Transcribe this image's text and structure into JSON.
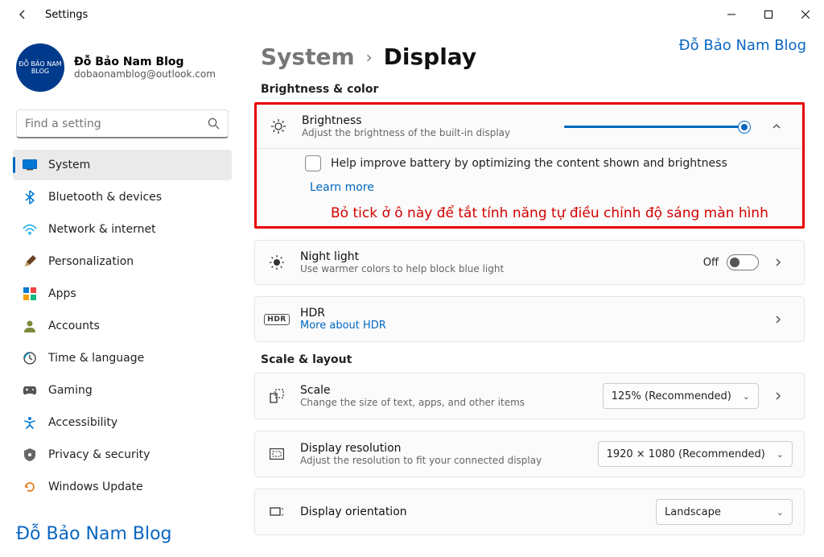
{
  "window": {
    "title": "Settings"
  },
  "user": {
    "name": "Đỗ Bảo Nam Blog",
    "email": "dobaonamblog@outlook.com",
    "avatar_text": "ĐỖ BẢO NAM BLOG"
  },
  "search": {
    "placeholder": "Find a setting"
  },
  "nav": {
    "items": [
      {
        "label": "System",
        "icon": "system"
      },
      {
        "label": "Bluetooth & devices",
        "icon": "bluetooth"
      },
      {
        "label": "Network & internet",
        "icon": "network"
      },
      {
        "label": "Personalization",
        "icon": "personalization"
      },
      {
        "label": "Apps",
        "icon": "apps"
      },
      {
        "label": "Accounts",
        "icon": "accounts"
      },
      {
        "label": "Time & language",
        "icon": "time"
      },
      {
        "label": "Gaming",
        "icon": "gaming"
      },
      {
        "label": "Accessibility",
        "icon": "accessibility"
      },
      {
        "label": "Privacy & security",
        "icon": "privacy"
      },
      {
        "label": "Windows Update",
        "icon": "update"
      }
    ],
    "active_index": 0
  },
  "breadcrumb": {
    "parent": "System",
    "current": "Display"
  },
  "sections": {
    "brightness_color": {
      "label": "Brightness & color"
    },
    "scale_layout": {
      "label": "Scale & layout"
    }
  },
  "brightness": {
    "title": "Brightness",
    "desc": "Adjust the brightness of the built-in display",
    "checkbox_label": "Help improve battery by optimizing the content shown and brightness",
    "learn_more": "Learn more",
    "annotation": "Bỏ tick ở ô này để tắt tính năng tự điều chỉnh độ sáng màn hình",
    "slider_percent": 100
  },
  "night_light": {
    "title": "Night light",
    "desc": "Use warmer colors to help block blue light",
    "state": "Off"
  },
  "hdr": {
    "title": "HDR",
    "link": "More about HDR"
  },
  "scale": {
    "title": "Scale",
    "desc": "Change the size of text, apps, and other items",
    "value": "125% (Recommended)"
  },
  "resolution": {
    "title": "Display resolution",
    "desc": "Adjust the resolution to fit your connected display",
    "value": "1920 × 1080 (Recommended)"
  },
  "orientation": {
    "title": "Display orientation",
    "value": "Landscape"
  },
  "brand": "Đỗ Bảo Nam Blog"
}
